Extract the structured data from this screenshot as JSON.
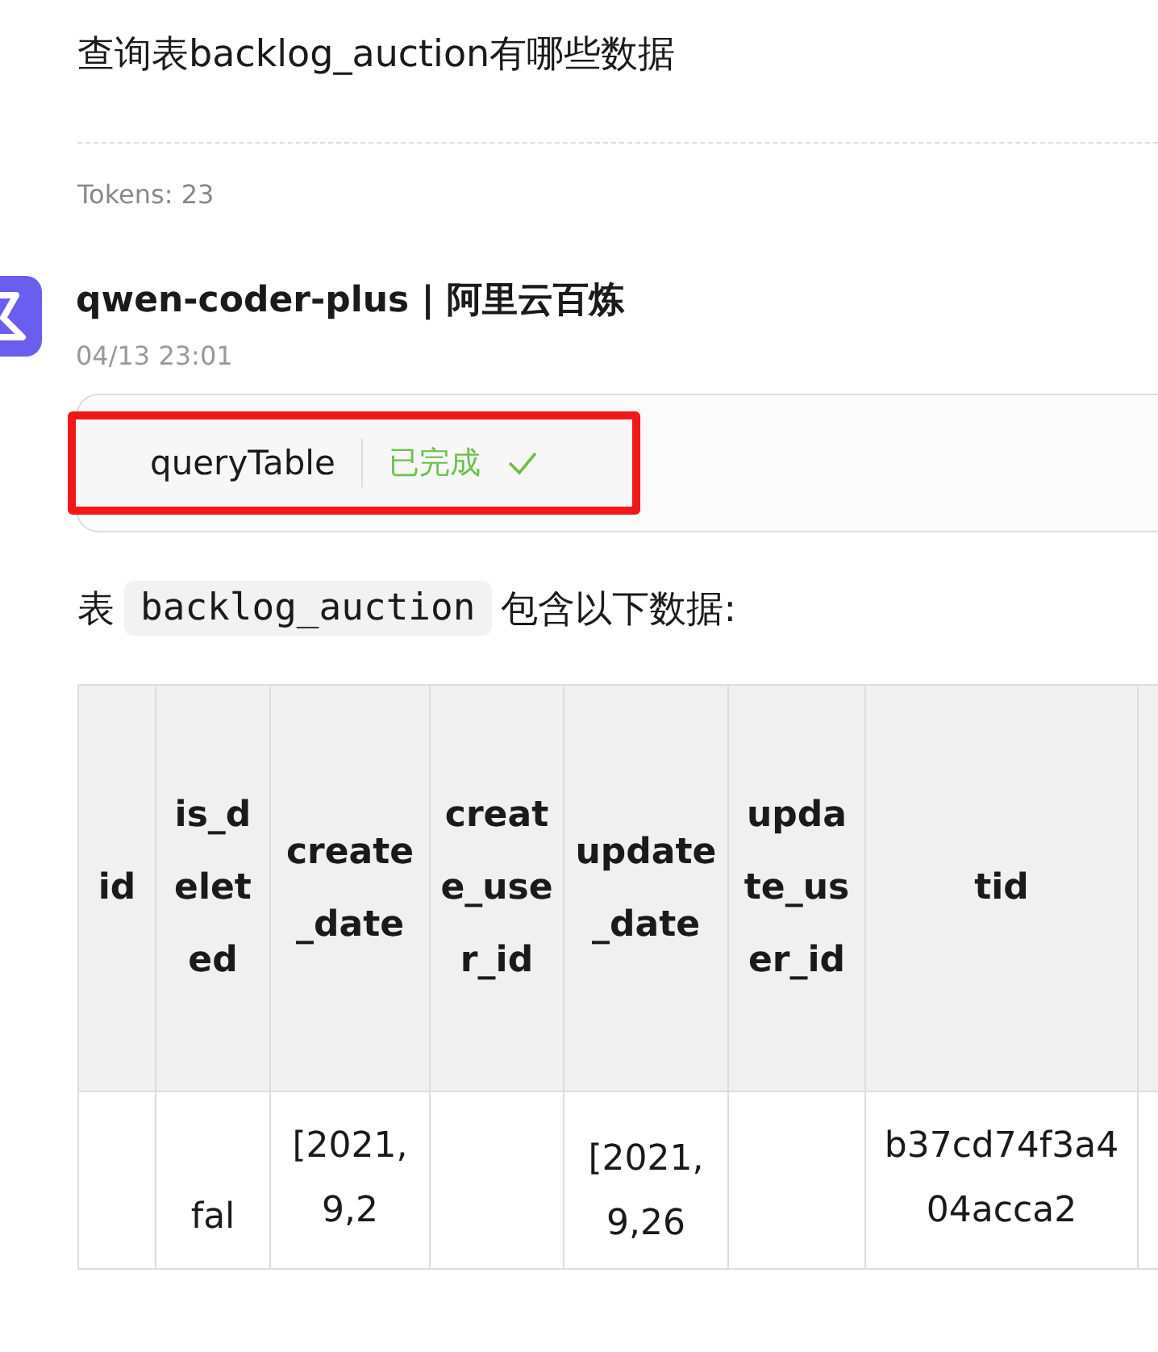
{
  "question": {
    "text": "查询表backlog_auction有哪些数据",
    "tokens": "Tokens: 23"
  },
  "reply": {
    "sender": "qwen-coder-plus | 阿里云百炼",
    "time": "04/13 23:01",
    "tool_call": {
      "name": "queryTable",
      "status": "已完成",
      "done": true
    },
    "intro": [
      "表",
      "backlog_auction",
      "包含以下数据:"
    ],
    "table": {
      "columns": [
        "id",
        "is_deleted",
        "create_date",
        "create_user_id",
        "update_date",
        "update_user_id",
        "tid",
        ""
      ],
      "rows": [
        [
          "",
          "fal",
          "[2021,9,2",
          "",
          "[2021,9,26",
          "",
          "b37cd74f3a404acca2",
          ""
        ]
      ]
    }
  }
}
